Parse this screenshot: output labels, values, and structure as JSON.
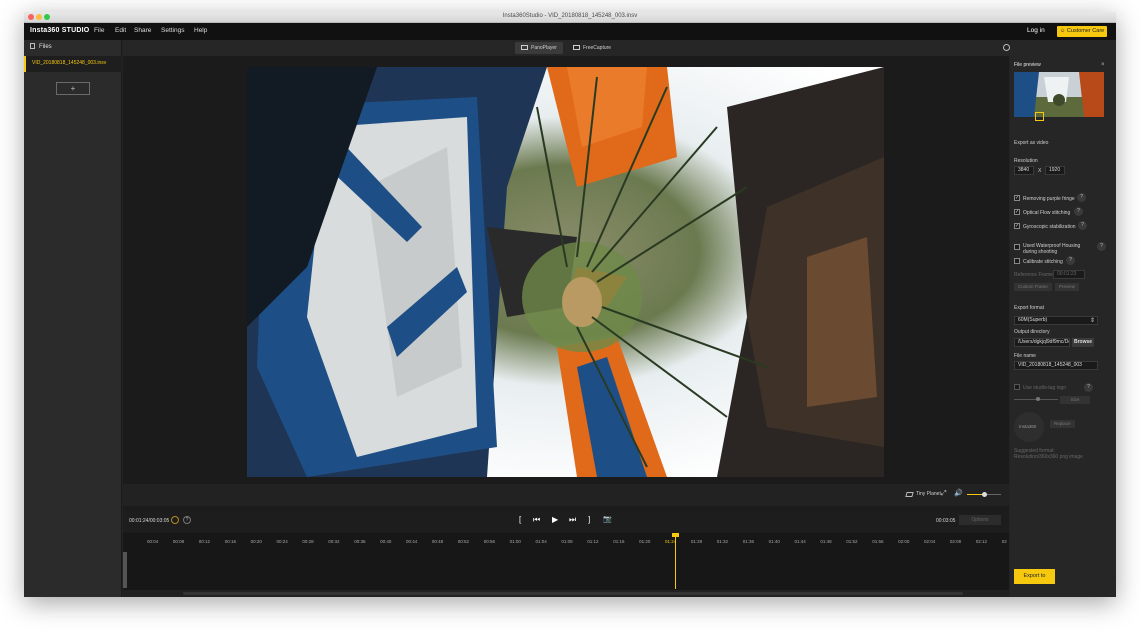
{
  "window": {
    "title": "Insta360Studio - VID_20180818_145248_003.insv"
  },
  "menubar": {
    "brand": "Insta360 STUDIO",
    "items": [
      "File",
      "Edit",
      "Share",
      "Settings",
      "Help"
    ],
    "login": "Log in",
    "customer_care": "Customer Care"
  },
  "sidebar": {
    "header": "Files",
    "files": [
      "VID_20180818_145248_003.insv"
    ],
    "add_label": "+"
  },
  "viewtabs": {
    "pano": "PanoPlayer",
    "free": "FreeCapture"
  },
  "playerbar": {
    "view_mode": "Tiny Planet",
    "volume": 0.5
  },
  "transport": {
    "timecode": "00:01:24/00:03:05",
    "end_time": "00:03:05",
    "disabled_button": "Options",
    "in_mark": "[",
    "prev": "⏮",
    "play": "▶",
    "next": "⏭",
    "out_mark": "]"
  },
  "timeline": {
    "ticks": [
      "00:04",
      "00:08",
      "00:12",
      "00:16",
      "00:20",
      "00:24",
      "00:28",
      "00:32",
      "00:36",
      "00:40",
      "00:44",
      "00:48",
      "00:52",
      "00:56",
      "01:00",
      "01:04",
      "01:08",
      "01:12",
      "01:16",
      "01:20",
      "01:24",
      "01:28",
      "01:32",
      "01:36",
      "01:40",
      "01:44",
      "01:48",
      "01:52",
      "01:56",
      "02:00",
      "02:04",
      "02:08",
      "02:12",
      "02"
    ],
    "playhead_label": "01:24"
  },
  "panel": {
    "title": "File preview",
    "export_as": "Export as video",
    "resolution_label": "Resolution",
    "res_w": "3840",
    "res_x": "X",
    "res_h": "1920",
    "options": [
      {
        "label": "Removing purple fringe",
        "checked": "✓"
      },
      {
        "label": "Optical Flow stitching",
        "checked": "✓"
      },
      {
        "label": "Gyroscopic stabilization",
        "checked": "✓"
      }
    ],
    "waterproof_label": "Used Waterproof Housing during shooting",
    "calibrate_label": "Calibrate stitching",
    "ref_frame_label": "Reference Frame",
    "ref_frame_value": "00:01:23",
    "custom_frame": "Custom Frame",
    "preview": "Preview",
    "format_label": "Export format",
    "format_value": "60M(Superb)",
    "output_label": "Output directory",
    "output_value": "/Users/dgkjql9df9mc/Deskt",
    "browse": "Browse",
    "filename_label": "File name",
    "filename_value": "VID_20180818_145248_003",
    "logo_label": "Use studio-tag logo",
    "logo_size": "Size",
    "watermark": "Insta360",
    "replace": "Replace",
    "suggest": "Suggested format: Resolution/360x360 png image",
    "export": "Export to"
  },
  "colors": {
    "accent": "#f6c90e",
    "panel": "#262626",
    "background": "#1b1b1b"
  }
}
